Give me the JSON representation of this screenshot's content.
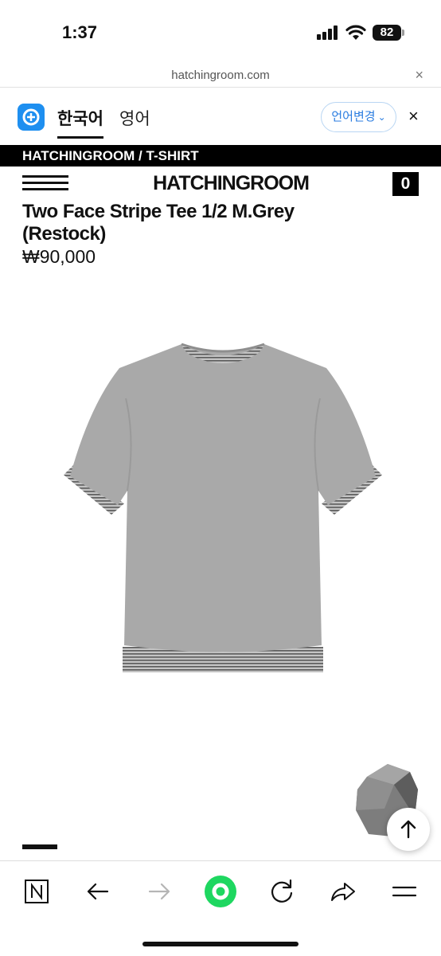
{
  "status_bar": {
    "time": "1:37",
    "battery": "82"
  },
  "browser": {
    "url": "hatchingroom.com",
    "close_symbol": "×"
  },
  "translate_bar": {
    "tabs": [
      {
        "label": "한국어",
        "active": true
      },
      {
        "label": "영어",
        "active": false
      }
    ],
    "change_language": "언어변경",
    "close_symbol": "×"
  },
  "breadcrumb": "HATCHINGROOM / T-SHIRT",
  "site": {
    "logo": "HATCHINGROOM",
    "cart_count": "0"
  },
  "product": {
    "title": "Two Face Stripe Tee 1/2 M.Grey (Restock)",
    "price": "₩90,000",
    "image_page_current": 1
  },
  "toolbar": {
    "icons": [
      "n-icon",
      "back-arrow-icon",
      "forward-arrow-icon",
      "home-circle-icon",
      "reload-icon",
      "share-icon",
      "menu-icon"
    ],
    "accent": "#1ed760"
  }
}
